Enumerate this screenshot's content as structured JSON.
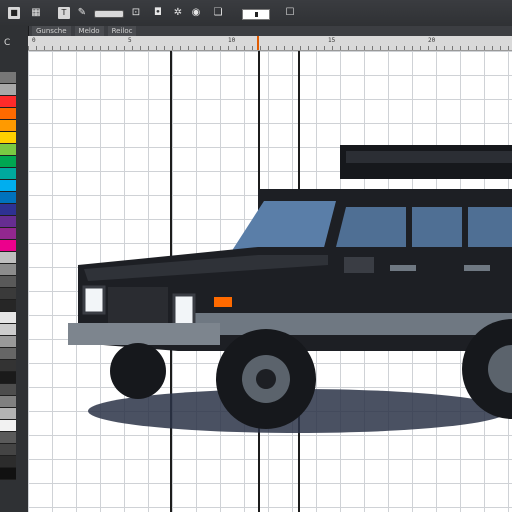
{
  "toolbar": {
    "tools": [
      {
        "icon": "square-icon",
        "glyph": "■"
      },
      {
        "icon": "text-icon",
        "glyph": "T"
      },
      {
        "icon": "stamp-icon",
        "glyph": "✲"
      },
      {
        "icon": "camera-icon",
        "glyph": "◉"
      }
    ],
    "zoom_field_value": ""
  },
  "tabs": [
    "Gunsche",
    "Meldo",
    "Reiloc"
  ],
  "sidebar": {
    "label": "C"
  },
  "ruler": {
    "marks": [
      "0",
      "5",
      "10",
      "15",
      "20"
    ]
  },
  "palette": [
    "#777777",
    "#a8a8a8",
    "#ff2a2a",
    "#ff6a00",
    "#ff9a00",
    "#ffd000",
    "#7ac943",
    "#00a651",
    "#00a99d",
    "#00aeef",
    "#0072bc",
    "#2e3192",
    "#662d91",
    "#92278f",
    "#ec008c",
    "#bfbfbf",
    "#8c8c8c",
    "#595959",
    "#3a3a3a",
    "#262626",
    "#e6e6e6",
    "#cccccc",
    "#999999",
    "#666666",
    "#333333",
    "#1a1a1a",
    "#4d4d4d",
    "#808080",
    "#b3b3b3",
    "#f2f2f2",
    "#5a5a5a",
    "#444444",
    "#2c2c2c",
    "#111111"
  ],
  "colors": {
    "accent": "#e05a00",
    "vehicle_body": "#1d1f24",
    "vehicle_trim": "#6f7882",
    "glass": "#5a7ea8"
  }
}
